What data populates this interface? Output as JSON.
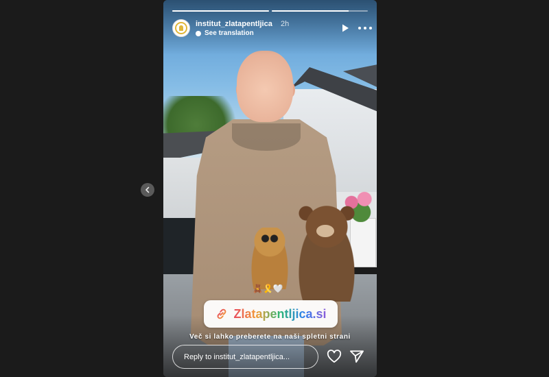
{
  "story": {
    "username": "institut_zlatapentljica",
    "time_ago": "2h",
    "translate_label": "See translation",
    "progress": [
      1,
      0.8
    ]
  },
  "stickers": {
    "emojis": "🧸🎗️🤍",
    "link_text": "Zlatapentljica.si",
    "caption": "Več si lahko preberete na naši spletni strani"
  },
  "reply": {
    "placeholder": "Reply to institut_zlatapentljica..."
  },
  "icons": {
    "prev": "chevron-left-icon",
    "play": "play-icon",
    "more": "more-icon",
    "link": "link-icon",
    "heart": "heart-icon",
    "send": "send-icon",
    "avatar": "golden-ribbon-logo"
  },
  "colors": {
    "background": "#1b1b1b",
    "link_gradient": [
      "#e84a5f",
      "#f29d38",
      "#2bb673",
      "#2f80ed",
      "#8e5bd9"
    ],
    "ribbon_gold": "#e0b73a"
  }
}
